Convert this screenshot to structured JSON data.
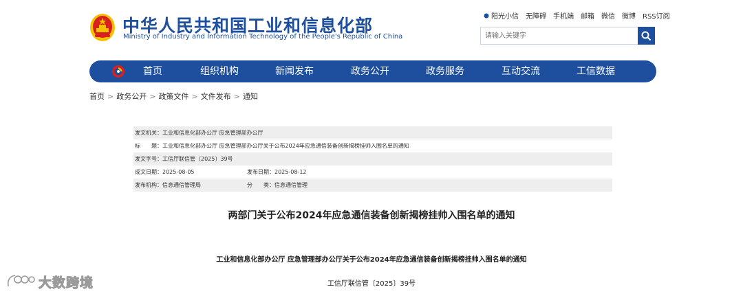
{
  "header": {
    "title_cn": "中华人民共和国工业和信息化部",
    "title_en": "Ministry of Industry and Information Technology of the People's Republic of China",
    "top_links": [
      "阳光小信",
      "无障碍",
      "手机端",
      "邮箱",
      "微信",
      "微博",
      "RSS订阅"
    ],
    "search_placeholder": "请输入关键字"
  },
  "nav": {
    "items": [
      "首页",
      "组织机构",
      "新闻发布",
      "政务公开",
      "政务服务",
      "互动交流",
      "工信数据"
    ]
  },
  "breadcrumb": [
    "首页",
    "政务公开",
    "政策文件",
    "文件发布",
    "通知"
  ],
  "info": {
    "issuer_label": "发文机关：",
    "issuer_value": "工业和信息化部办公厅 应急管理部办公厅",
    "title_label": "标　　题：",
    "title_value": "工业和信息化部办公厅 应急管理部办公厅关于公布2024年应急通信装备创新揭榜挂帅入围名单的通知",
    "docno_label": "发文字号：",
    "docno_value": "工信厅联信管〔2025〕39号",
    "created_label": "成文日期：",
    "created_value": "2025-08-05",
    "published_label": "发布日期：",
    "published_value": "2025-08-12",
    "agency_label": "发布机构：",
    "agency_value": "信息通信管理局",
    "category_label": "分　　类：",
    "category_value": "信息通信管理"
  },
  "article": {
    "title": "两部门关于公布2024年应急通信装备创新揭榜挂帅入围名单的通知",
    "subtitle": "工业和信息化部办公厅 应急管理部办公厅关于公布2024年应急通信装备创新揭榜挂帅入围名单的通知",
    "doc_number": "工信厅联信管〔2025〕39号"
  },
  "watermark": {
    "text": "大数跨境"
  },
  "colors": {
    "brand": "#1d4f9e",
    "emblem_red": "#d8201e",
    "emblem_gold": "#f5c000"
  }
}
